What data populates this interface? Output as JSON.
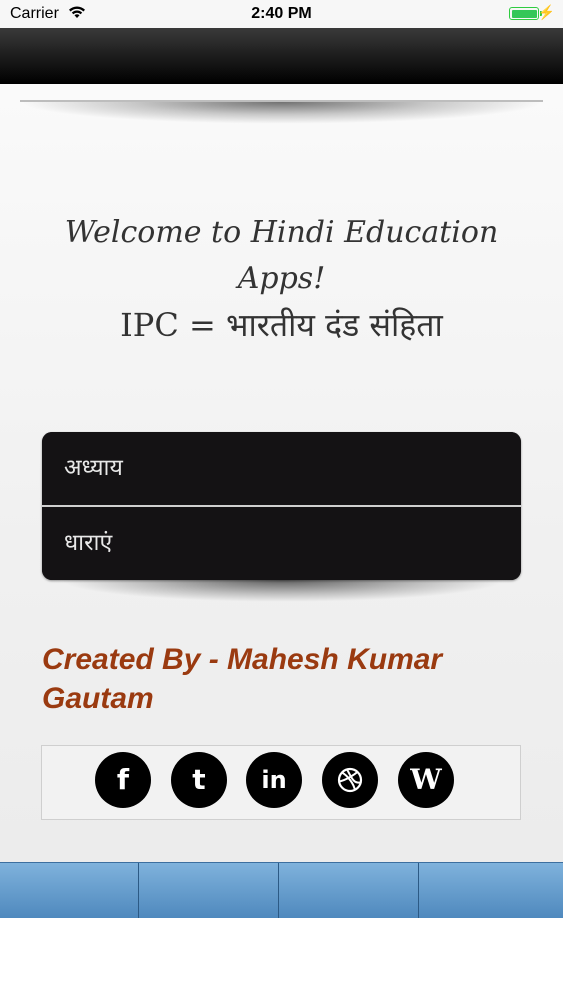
{
  "status_bar": {
    "carrier": "Carrier",
    "time": "2:40 PM",
    "wifi_icon": "wifi-icon",
    "battery_icon": "battery-full-icon",
    "charging_icon": "charging-bolt-icon"
  },
  "welcome": {
    "line1": "Welcome to Hindi Education",
    "line2": "Apps!",
    "line3": "IPC = भारतीय दंड संहिता"
  },
  "menu": {
    "items": [
      {
        "label": "अध्याय"
      },
      {
        "label": "धाराएं"
      }
    ]
  },
  "credit": {
    "line1": "Created By - Mahesh Kumar",
    "line2": "Gautam"
  },
  "social": {
    "icons": [
      "facebook-icon",
      "twitter-icon",
      "linkedin-icon",
      "dribbble-icon",
      "wordpress-icon"
    ],
    "facebook_glyph": "f",
    "twitter_glyph": "t",
    "linkedin_glyph": "in",
    "wordpress_glyph": "W"
  },
  "tab_bar": {
    "tabs": [
      "",
      "",
      "",
      ""
    ]
  },
  "colors": {
    "credit_text": "#9a3a10",
    "menu_bg": "#141214",
    "tab_bar_top": "#7fb2dc",
    "tab_bar_bottom": "#4e88bd"
  }
}
